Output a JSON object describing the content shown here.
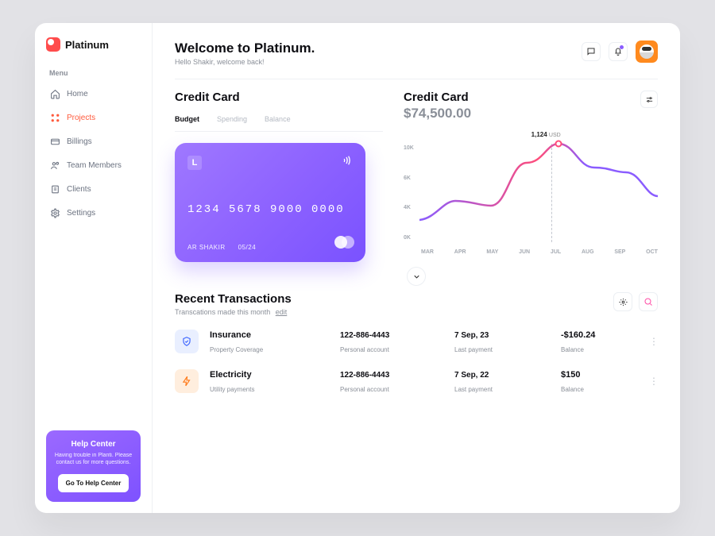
{
  "brand": "Platinum",
  "sidebar": {
    "menu_label": "Menu",
    "items": [
      {
        "label": "Home",
        "icon": "home-icon"
      },
      {
        "label": "Projects",
        "icon": "grid-icon"
      },
      {
        "label": "Billings",
        "icon": "card-icon"
      },
      {
        "label": "Team Members",
        "icon": "users-icon"
      },
      {
        "label": "Clients",
        "icon": "client-icon"
      },
      {
        "label": "Settings",
        "icon": "gear-icon"
      }
    ],
    "active_index": 1
  },
  "help": {
    "title": "Help Center",
    "body": "Having trouble in Planti. Please contact us for more questions.",
    "cta": "Go To Help Center"
  },
  "header": {
    "title": "Welcome to Platinum.",
    "subtitle": "Hello Shakir, welcome back!"
  },
  "credit_card_section": {
    "title": "Credit Card",
    "tabs": [
      "Budget",
      "Spending",
      "Balance"
    ],
    "active_tab": 0,
    "card": {
      "number": "1234  5678  9000  0000",
      "holder": "AR SHAKIR",
      "expiry": "05/24"
    }
  },
  "balance_section": {
    "title": "Credit Card",
    "amount": "$74,500.00",
    "tooltip_value": "1,124",
    "tooltip_unit": "USD"
  },
  "chart_data": {
    "type": "area",
    "title": "Credit Card",
    "xlabel": "",
    "ylabel": "",
    "ylim": [
      0,
      10
    ],
    "y_ticks": [
      "10K",
      "6K",
      "4K",
      "0K"
    ],
    "categories": [
      "MAR",
      "APR",
      "MAY",
      "JUN",
      "JUL",
      "AUG",
      "SEP",
      "OCT"
    ],
    "values": [
      1.5,
      3.5,
      3.0,
      7.5,
      9.5,
      7.0,
      6.5,
      4.0
    ],
    "highlight": {
      "index": 4,
      "label": "1,124 USD"
    },
    "colors": {
      "stroke": "#8a5cff",
      "peak": "#ff4d7a"
    }
  },
  "transactions": {
    "title": "Recent Transactions",
    "subtitle": "Transcations made this month",
    "edit_label": "edit",
    "rows": [
      {
        "icon": "shield-icon",
        "icon_tone": "blue",
        "name": "Insurance",
        "desc": "Property Coverage",
        "acct": "122-886-4443",
        "acct_label": "Personal account",
        "date": "7 Sep, 23",
        "date_label": "Last payment",
        "amount": "-$160.24",
        "amount_label": "Balance"
      },
      {
        "icon": "bolt-icon",
        "icon_tone": "orange",
        "name": "Electricity",
        "desc": "Utility payments",
        "acct": "122-886-4443",
        "acct_label": "Personal account",
        "date": "7 Sep, 22",
        "date_label": "Last payment",
        "amount": "$150",
        "amount_label": "Balance"
      }
    ]
  }
}
